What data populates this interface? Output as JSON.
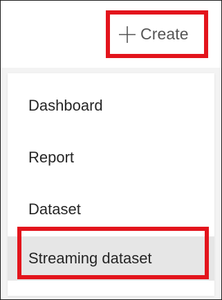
{
  "header": {
    "create_label": "Create",
    "create_icon": "plus-icon"
  },
  "menu": {
    "items": [
      {
        "label": "Dashboard"
      },
      {
        "label": "Report"
      },
      {
        "label": "Dataset"
      },
      {
        "label": "Streaming dataset",
        "highlighted": true
      }
    ]
  },
  "colors": {
    "callout_red": "#e3141c",
    "menu_background": "#f3f3f3",
    "highlight_background": "#e6e6e6",
    "text": "#252525"
  }
}
